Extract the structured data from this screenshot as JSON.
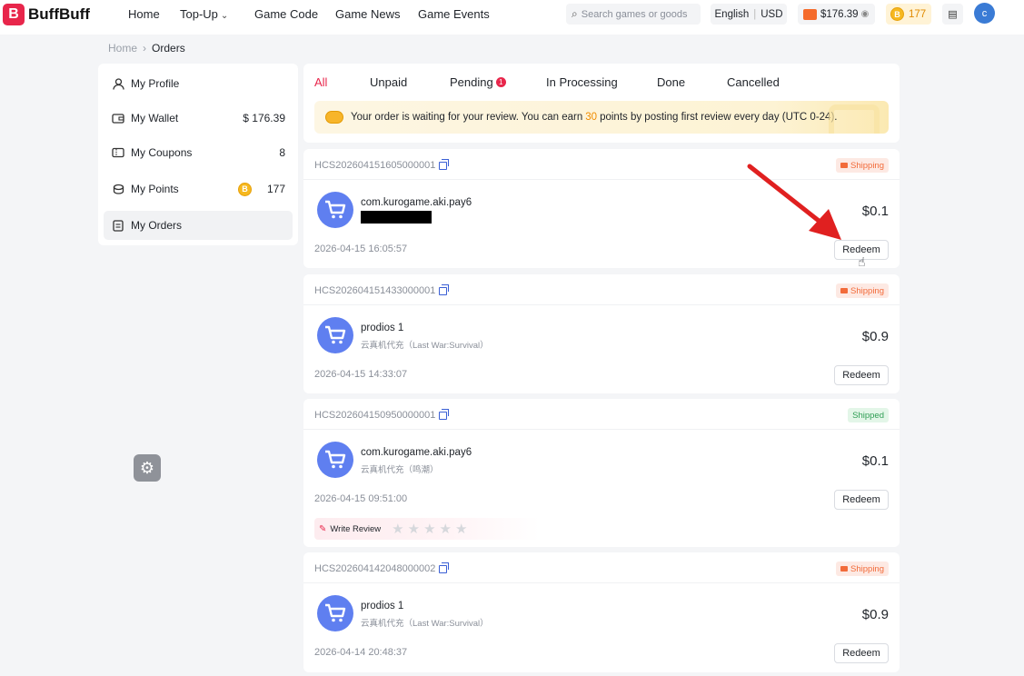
{
  "header": {
    "logo_text": "BuffBuff",
    "nav": [
      {
        "label": "Home",
        "has_dropdown": false
      },
      {
        "label": "Top-Up",
        "has_dropdown": true
      },
      {
        "label": "Game Code",
        "has_dropdown": false
      },
      {
        "label": "Game News",
        "has_dropdown": false
      },
      {
        "label": "Game Events",
        "has_dropdown": false
      }
    ],
    "search_placeholder": "Search games or goods",
    "language": "English",
    "currency": "USD",
    "wallet_balance": "$176.39",
    "points": "177",
    "avatar_initial": "c"
  },
  "breadcrumb": {
    "home": "Home",
    "current": "Orders"
  },
  "sidebar": {
    "items": [
      {
        "label": "My Profile",
        "icon": "user-icon",
        "value": ""
      },
      {
        "label": "My Wallet",
        "icon": "wallet-icon",
        "value": "$ 176.39"
      },
      {
        "label": "My Coupons",
        "icon": "ticket-icon",
        "value": "8"
      },
      {
        "label": "My Points",
        "icon": "coins-icon",
        "value": "177"
      },
      {
        "label": "My Orders",
        "icon": "document-icon",
        "value": "",
        "active": true
      }
    ]
  },
  "tabs": [
    {
      "label": "All",
      "active": true
    },
    {
      "label": "Unpaid"
    },
    {
      "label": "Pending",
      "badge": "1"
    },
    {
      "label": "In Processing"
    },
    {
      "label": "Done"
    },
    {
      "label": "Cancelled"
    }
  ],
  "notice": {
    "before": "Your order is waiting for your review. You can earn",
    "points": "30",
    "after": "points by posting first review every day (UTC 0-24)."
  },
  "orders": [
    {
      "id": "HCS202604151605000001",
      "status": "Shipping",
      "status_type": "shipping",
      "product": "com.kurogame.aki.pay6",
      "subtitle": "",
      "redacted": true,
      "price": "$0.1",
      "time": "2026-04-15 16:05:57",
      "action": "Redeem"
    },
    {
      "id": "HCS202604151433000001",
      "status": "Shipping",
      "status_type": "shipping",
      "product": "prodios 1",
      "subtitle": "云真机代充（Last War:Survival）",
      "redacted": false,
      "price": "$0.9",
      "time": "2026-04-15 14:33:07",
      "action": "Redeem"
    },
    {
      "id": "HCS202604150950000001",
      "status": "Shipped",
      "status_type": "shipped",
      "product": "com.kurogame.aki.pay6",
      "subtitle": "云真机代充（鸣潮）",
      "redacted": false,
      "price": "$0.1",
      "time": "2026-04-15 09:51:00",
      "action": "Redeem",
      "review_label": "Write Review"
    },
    {
      "id": "HCS202604142048000002",
      "status": "Shipping",
      "status_type": "shipping",
      "product": "prodios 1",
      "subtitle": "云真机代充（Last War:Survival）",
      "redacted": false,
      "price": "$0.9",
      "time": "2026-04-14 20:48:37",
      "action": "Redeem"
    }
  ],
  "colors": {
    "accent": "#e8264b",
    "cart": "#5f7ff0",
    "shipping": "#f26b3a",
    "shipped": "#2f9e54",
    "annotation_arrow": "#e02020"
  }
}
